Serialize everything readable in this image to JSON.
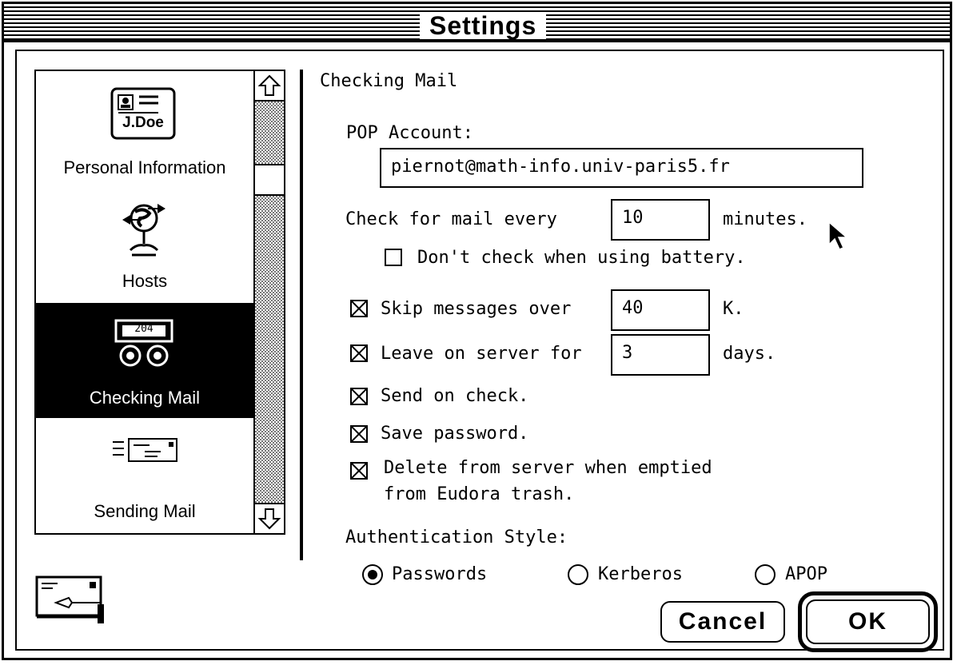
{
  "window": {
    "title": "Settings"
  },
  "sidebar": {
    "items": [
      {
        "label": "Personal Information",
        "icon": "personal-info-card-icon",
        "icon_text": "J.Doe"
      },
      {
        "label": "Hosts",
        "icon": "hosts-globe-icon"
      },
      {
        "label": "Checking Mail",
        "icon": "checking-mail-counter-icon",
        "icon_text": "204",
        "selected": true
      },
      {
        "label": "Sending Mail",
        "icon": "sending-mail-envelope-icon"
      }
    ]
  },
  "panel": {
    "heading": "Checking Mail",
    "pop_account": {
      "label": "POP Account:",
      "value": "piernot@math-info.univ-paris5.fr"
    },
    "check_every": {
      "prefix": "Check for mail every",
      "value": "10",
      "suffix": "minutes."
    },
    "battery": {
      "label": "Don't check when using battery.",
      "checked": false
    },
    "skip": {
      "label": "Skip messages over",
      "value": "40",
      "suffix": "K.",
      "checked": true
    },
    "leave": {
      "label": "Leave on server for",
      "value": "3",
      "suffix": "days.",
      "checked": true
    },
    "send_on_check": {
      "label": "Send on check.",
      "checked": true
    },
    "save_password": {
      "label": "Save password.",
      "checked": true
    },
    "delete_from_server": {
      "line1": "Delete from server when emptied",
      "line2": "from Eudora trash.",
      "checked": true
    },
    "auth": {
      "label": "Authentication Style:",
      "options": [
        {
          "label": "Passwords",
          "selected": true
        },
        {
          "label": "Kerberos",
          "selected": false
        },
        {
          "label": "APOP",
          "selected": false
        }
      ]
    }
  },
  "buttons": {
    "cancel": "Cancel",
    "ok": "OK"
  },
  "footer_icon": "eudora-mail-signature-icon"
}
